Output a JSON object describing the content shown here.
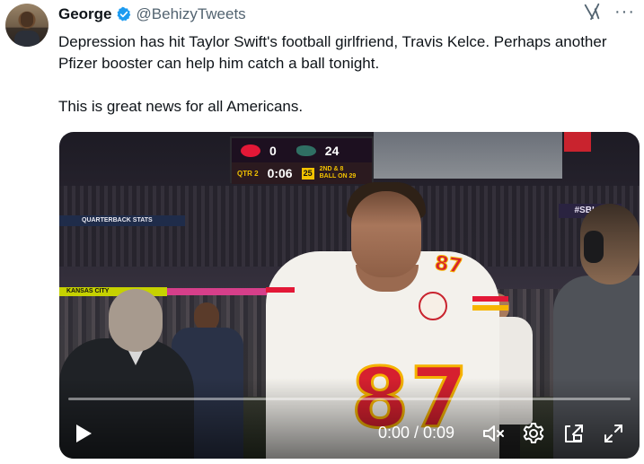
{
  "author": {
    "name": "George",
    "handle": "@BehizyTweets",
    "verified": true,
    "avatar_icon": "avatar-photo"
  },
  "header_actions": {
    "grok_icon": "grok-icon",
    "more_icon": "more-icon",
    "more_glyph": "···"
  },
  "tweet": {
    "text": "Depression has hit Taylor Swift's football girlfriend, Travis Kelce. Perhaps another Pfizer booster can help him catch a ball tonight.\n\nThis is great news for all Americans."
  },
  "video": {
    "time_display": "0:00 / 0:09",
    "progress": 0.0,
    "scoreboard": {
      "kc_score": "0",
      "phi_score": "24",
      "quarter": "QTR 2",
      "clock": "0:06",
      "play_clock": "25",
      "down_line1": "2ND & 8",
      "down_line2": "BALL ON 29"
    },
    "signage": {
      "sblix": "#SBLIX",
      "qb_stats": "QUARTERBACK STATS",
      "kc_ribbon": "KANSAS CITY"
    },
    "jersey_number": "87",
    "controls": {
      "play": "play-icon",
      "volume": "volume-muted-icon",
      "settings": "gear-icon",
      "pip": "pip-icon",
      "fullscreen": "expand-icon"
    }
  },
  "colors": {
    "verified_blue": "#1d9bf0",
    "text_primary": "#0f1419",
    "text_secondary": "#536471",
    "chiefs_red": "#e31837"
  }
}
